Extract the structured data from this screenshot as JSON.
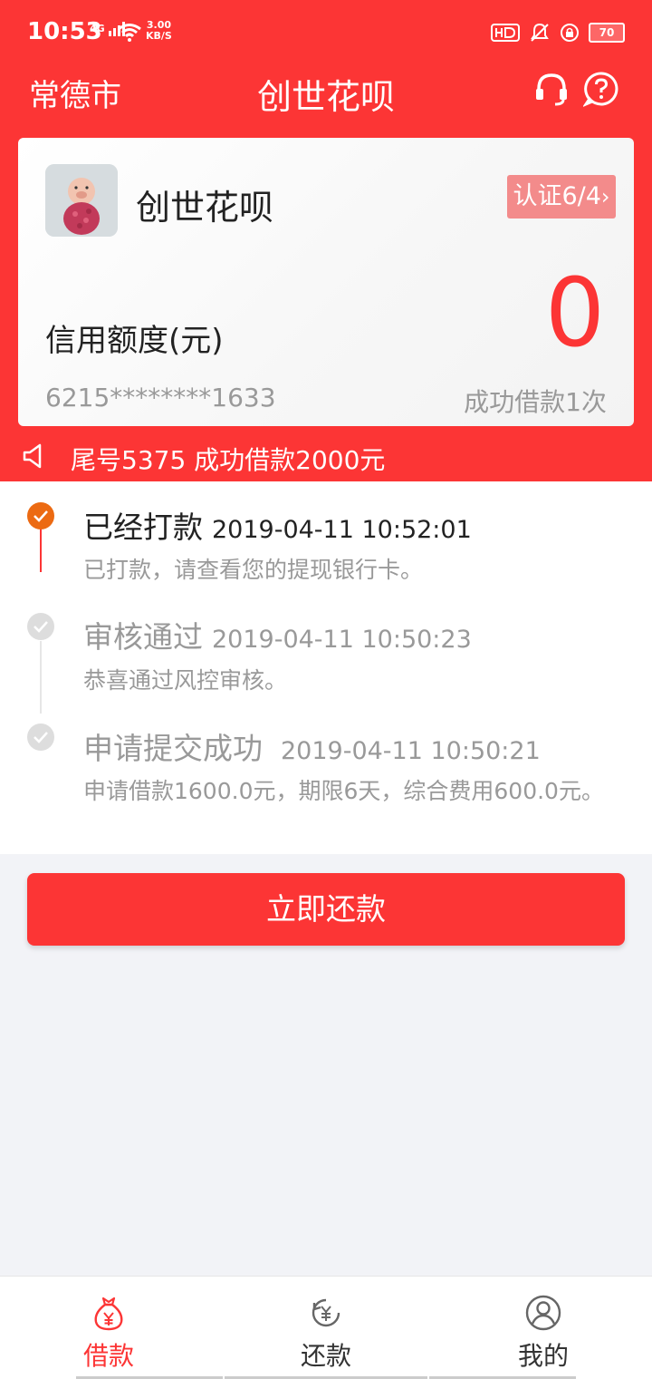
{
  "status_bar": {
    "time": "10:53",
    "network": "4G",
    "speed_value": "3.00",
    "speed_unit": "KB/S",
    "battery": "70"
  },
  "header": {
    "city": "常德市",
    "title": "创世花呗"
  },
  "card": {
    "app_name": "创世花呗",
    "cert_label": "认证6/4",
    "credit_label": "信用额度(元)",
    "credit_value": "0",
    "card_number": "6215********1633",
    "success_count": "成功借款1次"
  },
  "notice": {
    "text": "尾号5375 成功借款2000元"
  },
  "timeline": [
    {
      "title": "已经打款",
      "time": "2019-04-11 10:52:01",
      "desc": "已打款，请查看您的提现银行卡。"
    },
    {
      "title": "审核通过",
      "time": "2019-04-11 10:50:23",
      "desc": "恭喜通过风控审核。"
    },
    {
      "title": "申请提交成功",
      "time": "2019-04-11 10:50:21",
      "desc": "申请借款1600.0元，期限6天，综合费用600.0元。"
    }
  ],
  "repay_button": "立即还款",
  "tabs": [
    {
      "label": "借款",
      "icon": "money-bag-icon"
    },
    {
      "label": "还款",
      "icon": "refund-yuan-icon"
    },
    {
      "label": "我的",
      "icon": "user-icon"
    }
  ],
  "colors": {
    "brand_red": "#fc3535",
    "step_active": "#ec6a12",
    "step_inactive": "#dddddd"
  }
}
